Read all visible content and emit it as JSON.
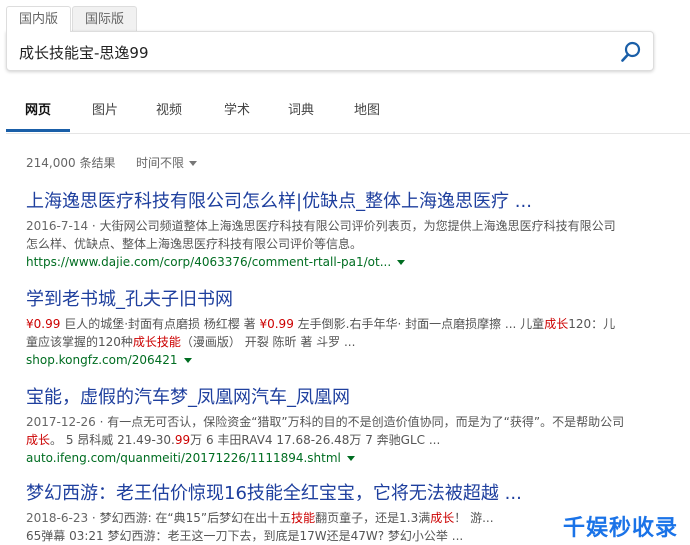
{
  "region_tabs": {
    "domestic": "国内版",
    "international": "国际版"
  },
  "search": {
    "query": "成长技能宝-思逸99"
  },
  "nav": {
    "web": "网页",
    "images": "图片",
    "videos": "视频",
    "academic": "学术",
    "dictionary": "词典",
    "maps": "地图"
  },
  "results_meta": {
    "count": "214,000 条结果",
    "time_filter": "时间不限"
  },
  "results": [
    {
      "title": "上海逸思医疗科技有限公司怎么样|优缺点_整体上海逸思医疗 ...",
      "date": "2016-7-14",
      "snippet_a": "大街网公司频道整体上海逸思医疗科技有限公司评价列表页，为您提供上海逸思医疗科技有限公司怎么样、优缺点、整体上海逸思医疗科技有限公司评价等信息。",
      "url": "https://www.dajie.com/corp/4063376/comment-rtall-pa1/ot..."
    },
    {
      "title": "学到老书城_孔夫子旧书网",
      "p1": "¥0.99",
      "s1": "巨人的城堡·封面有点磨损 杨红樱 著",
      "p2": "¥0.99",
      "s2": "左手倒影.右手年华· 封面一点磨损摩擦 ... 儿童",
      "h1": "成长",
      "s3": "120：儿童应该掌握的120种",
      "h2": "成长技能",
      "s4": "（漫画版） 开裂 陈昕 著 斗罗 ...",
      "url": "shop.kongfz.com/206421"
    },
    {
      "title": "宝能，虚假的汽车梦_凤凰网汽车_凤凰网",
      "date": "2017-12-26",
      "s1": "有一点无可否认，保险资金“猎取”万科的目的不是创造价值协同，而是为了“获得”。不是帮助公司",
      "h1": "成长",
      "s2": "。 5 昂科威 21.49-30.",
      "h2": "99",
      "s3": "万 6 丰田RAV4 17.68-26.48万 7 奔驰GLC ...",
      "url": "auto.ifeng.com/quanmeiti/20171226/1111894.shtml"
    },
    {
      "title": "梦幻西游：老王估价惊现16技能全红宝宝，它将无法被超越 ...",
      "date": "2018-6-23",
      "s1": "梦幻西游: 在“典15”后梦幻在出十五",
      "h1": "技能",
      "s2": "翻页童子，还是1.3满",
      "h2": "成长",
      "s3": "！ 游...",
      "s4": "65弹幕 03:21 梦幻西游：老王这一刀下去，到底是17W还是47W? 梦幻小公举 ..."
    }
  ],
  "watermark": "千娱秒收录"
}
